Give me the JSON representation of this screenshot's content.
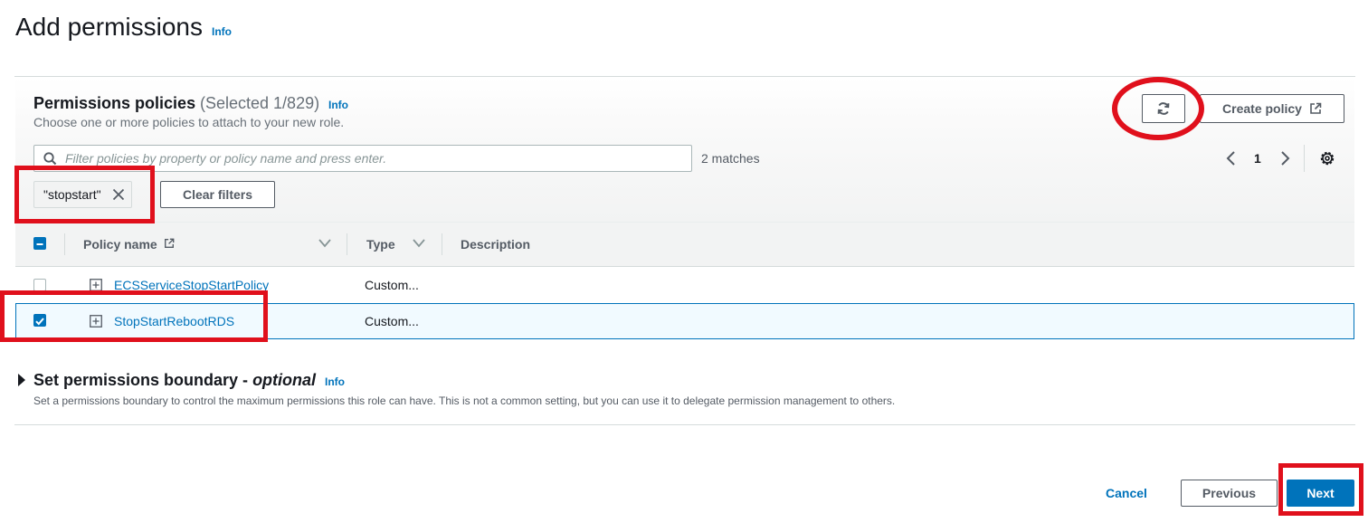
{
  "header": {
    "title": "Add permissions",
    "info": "Info"
  },
  "policies": {
    "title": "Permissions policies",
    "count": "(Selected 1/829)",
    "info": "Info",
    "description": "Choose one or more policies to attach to your new role.",
    "create_policy": "Create policy",
    "search_placeholder": "Filter policies by property or policy name and press enter.",
    "matches": "2 matches",
    "page": "1",
    "filter_token": "\"stopstart\"",
    "clear_filters": "Clear filters",
    "columns": {
      "name": "Policy name",
      "type": "Type",
      "description": "Description"
    },
    "rows": [
      {
        "name": "ECSServiceStopStartPolicy",
        "type": "Custom...",
        "selected": false
      },
      {
        "name": "StopStartRebootRDS",
        "type": "Custom...",
        "selected": true
      }
    ]
  },
  "boundary": {
    "title": "Set permissions boundary - ",
    "optional": "optional",
    "info": "Info",
    "description": "Set a permissions boundary to control the maximum permissions this role can have. This is not a common setting, but you can use it to delegate permission management to others."
  },
  "footer": {
    "cancel": "Cancel",
    "previous": "Previous",
    "next": "Next"
  },
  "colors": {
    "accent": "#0073bb",
    "annotation": "#e0101c"
  },
  "icons": [
    "refresh-icon",
    "external-link-icon",
    "search-icon",
    "chevron-left-icon",
    "chevron-right-icon",
    "gear-icon",
    "close-icon",
    "sort-down-icon",
    "expand-icon",
    "caret-right-icon"
  ]
}
